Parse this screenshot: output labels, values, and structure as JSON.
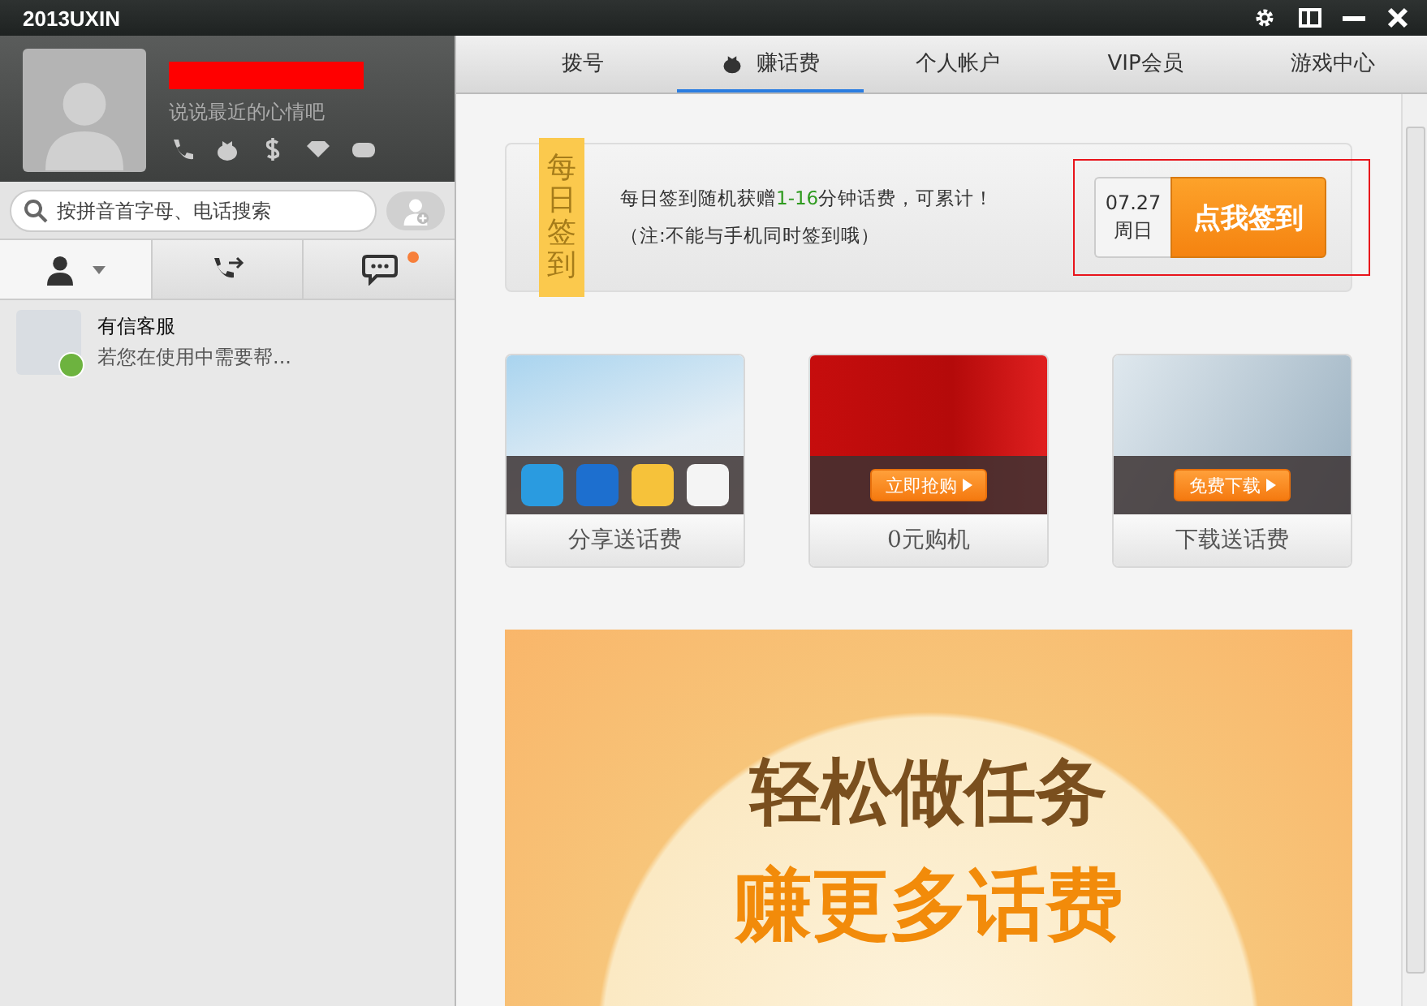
{
  "window": {
    "title": "2013UXIN"
  },
  "profile": {
    "status_placeholder": "说说最近的心情吧"
  },
  "search": {
    "placeholder": "按拼音首字母、电话搜索"
  },
  "side_tabs": [
    {
      "kind": "contacts",
      "selected": true,
      "badge": false
    },
    {
      "kind": "calls",
      "selected": false,
      "badge": false
    },
    {
      "kind": "messages",
      "selected": false,
      "badge": true
    }
  ],
  "contacts": [
    {
      "name": "有信客服",
      "preview": "若您在使用中需要帮..."
    }
  ],
  "tabs": [
    {
      "label": "拨号",
      "selected": false,
      "icon": false
    },
    {
      "label": "赚话费",
      "selected": true,
      "icon": true
    },
    {
      "label": "个人帐户",
      "selected": false,
      "icon": false
    },
    {
      "label": "VIP会员",
      "selected": false,
      "icon": false
    },
    {
      "label": "游戏中心",
      "selected": false,
      "icon": false
    }
  ],
  "sign_in": {
    "ribbon": "每日签到",
    "description": [
      {
        "text": "每日签到随机获赠",
        "highlight": false
      },
      {
        "text": "1-16",
        "highlight": true
      },
      {
        "text": "分钟话费，可累计！",
        "highlight": false
      }
    ],
    "note": "（注:不能与手机同时签到哦）",
    "date": "07.27",
    "weekday": "周日",
    "button": "点我签到"
  },
  "promos": [
    {
      "kind": "share",
      "caption": "分享送话费"
    },
    {
      "kind": "shop",
      "button": "立即抢购",
      "caption": "0元购机"
    },
    {
      "kind": "download",
      "button": "免费下载",
      "caption": "下载送话费"
    }
  ],
  "banner": {
    "line_1": "轻松做任务",
    "line_2": "赚更多话费"
  }
}
